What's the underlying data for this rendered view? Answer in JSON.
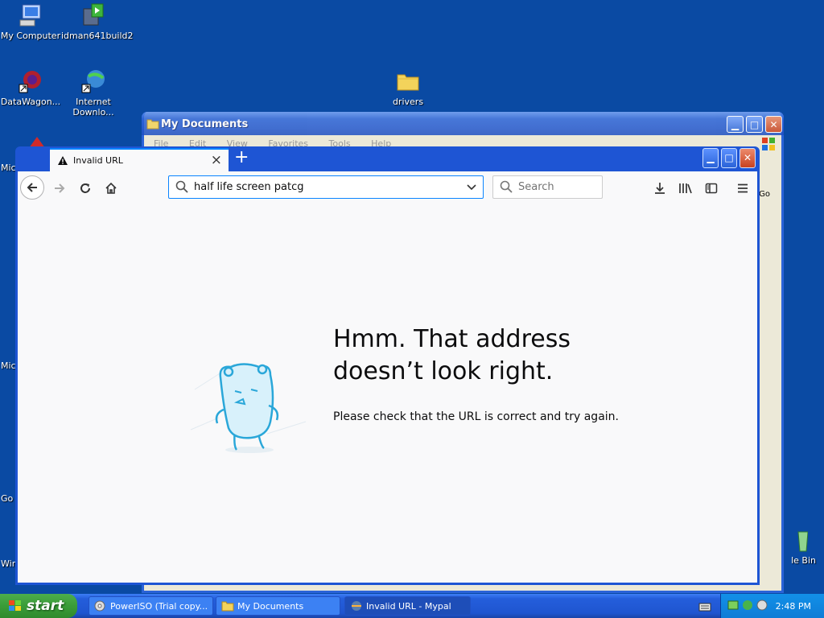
{
  "desktop": {
    "icons": [
      {
        "label": "My Computer"
      },
      {
        "label": "idman641build2"
      },
      {
        "label": "DataWagon..."
      },
      {
        "label_line1": "Internet",
        "label_line2": "Downlo..."
      },
      {
        "label": "drivers"
      },
      {
        "label": "le Bin"
      }
    ],
    "partial_labels": [
      "Mic",
      "Mic",
      "Go",
      "Wir",
      "Go"
    ]
  },
  "my_documents_window": {
    "title": "My Documents",
    "menu": [
      "File",
      "Edit",
      "View",
      "Favorites",
      "Tools",
      "Help"
    ]
  },
  "browser": {
    "tab": {
      "title": "Invalid URL"
    },
    "url_value": "half life screen patcg",
    "search_placeholder": "Search",
    "error": {
      "title_line1": "Hmm. That address",
      "title_line2": "doesn’t look right.",
      "description": "Please check that the URL is correct and try again."
    }
  },
  "taskbar": {
    "start_label": "start",
    "tasks": [
      {
        "label": "PowerISO (Trial copy..."
      },
      {
        "label": "My Documents"
      },
      {
        "label": "Invalid URL - Mypal"
      }
    ],
    "clock": "2:48 PM"
  },
  "colors": {
    "desktop": "#0a4aa3",
    "accent": "#0a84ff",
    "titlebar": "#1e55d4"
  }
}
